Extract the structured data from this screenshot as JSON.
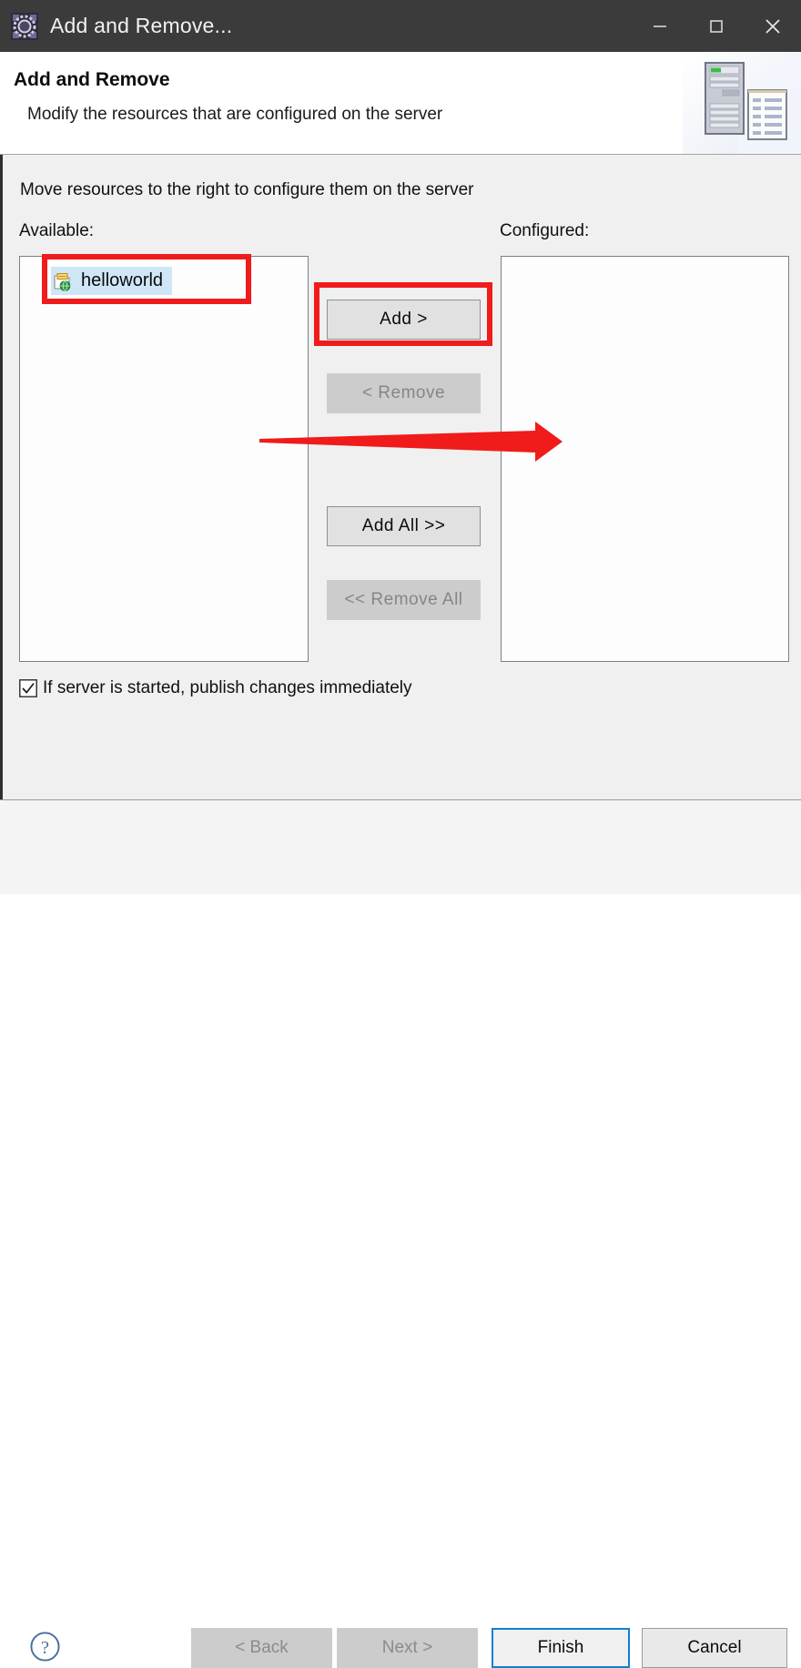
{
  "window": {
    "title": "Add and Remove...",
    "icon": "eclipse-gear-icon",
    "controls": {
      "minimize": "minimize-icon",
      "maximize": "maximize-icon",
      "close": "close-icon"
    }
  },
  "header": {
    "title": "Add and Remove",
    "description": "Modify the resources that are configured on the server",
    "artwork": "server-and-document-illustration"
  },
  "body": {
    "instruction": "Move resources to the right to configure them on the server",
    "available_label": "Available:",
    "configured_label": "Configured:",
    "available_items": [
      {
        "label": "helloworld",
        "icon": "web-project-icon",
        "selected": true
      }
    ],
    "configured_items": [],
    "transfer_buttons": [
      {
        "label": "Add >",
        "enabled": true,
        "name": "add-button"
      },
      {
        "label": "< Remove",
        "enabled": false,
        "name": "remove-button"
      },
      {
        "label": "Add All >>",
        "enabled": true,
        "name": "add-all-button"
      },
      {
        "label": "<< Remove All",
        "enabled": false,
        "name": "remove-all-button"
      }
    ],
    "publish_checkbox": {
      "label": "If server is started, publish changes immediately",
      "checked": true
    }
  },
  "footer": {
    "help": "help-icon",
    "buttons": [
      {
        "label": "< Back",
        "state": "disabled",
        "name": "back-button"
      },
      {
        "label": "Next >",
        "state": "disabled",
        "name": "next-button"
      },
      {
        "label": "Finish",
        "state": "default",
        "name": "finish-button"
      },
      {
        "label": "Cancel",
        "state": "enabled",
        "name": "cancel-button"
      }
    ]
  },
  "annotations": {
    "highlight_color": "#f01b1b",
    "boxes": [
      "available-item-helloworld",
      "add-button"
    ],
    "arrow": "points-right-from-available-list-to-configured-list"
  },
  "colors": {
    "titlebar_bg": "#3b3b3b",
    "dialog_bg": "#f0f0f0",
    "header_bg": "#ffffff",
    "selection_bg": "#cfe6f7",
    "focus_border": "#0f7fd4",
    "annotation_red": "#f01b1b"
  }
}
